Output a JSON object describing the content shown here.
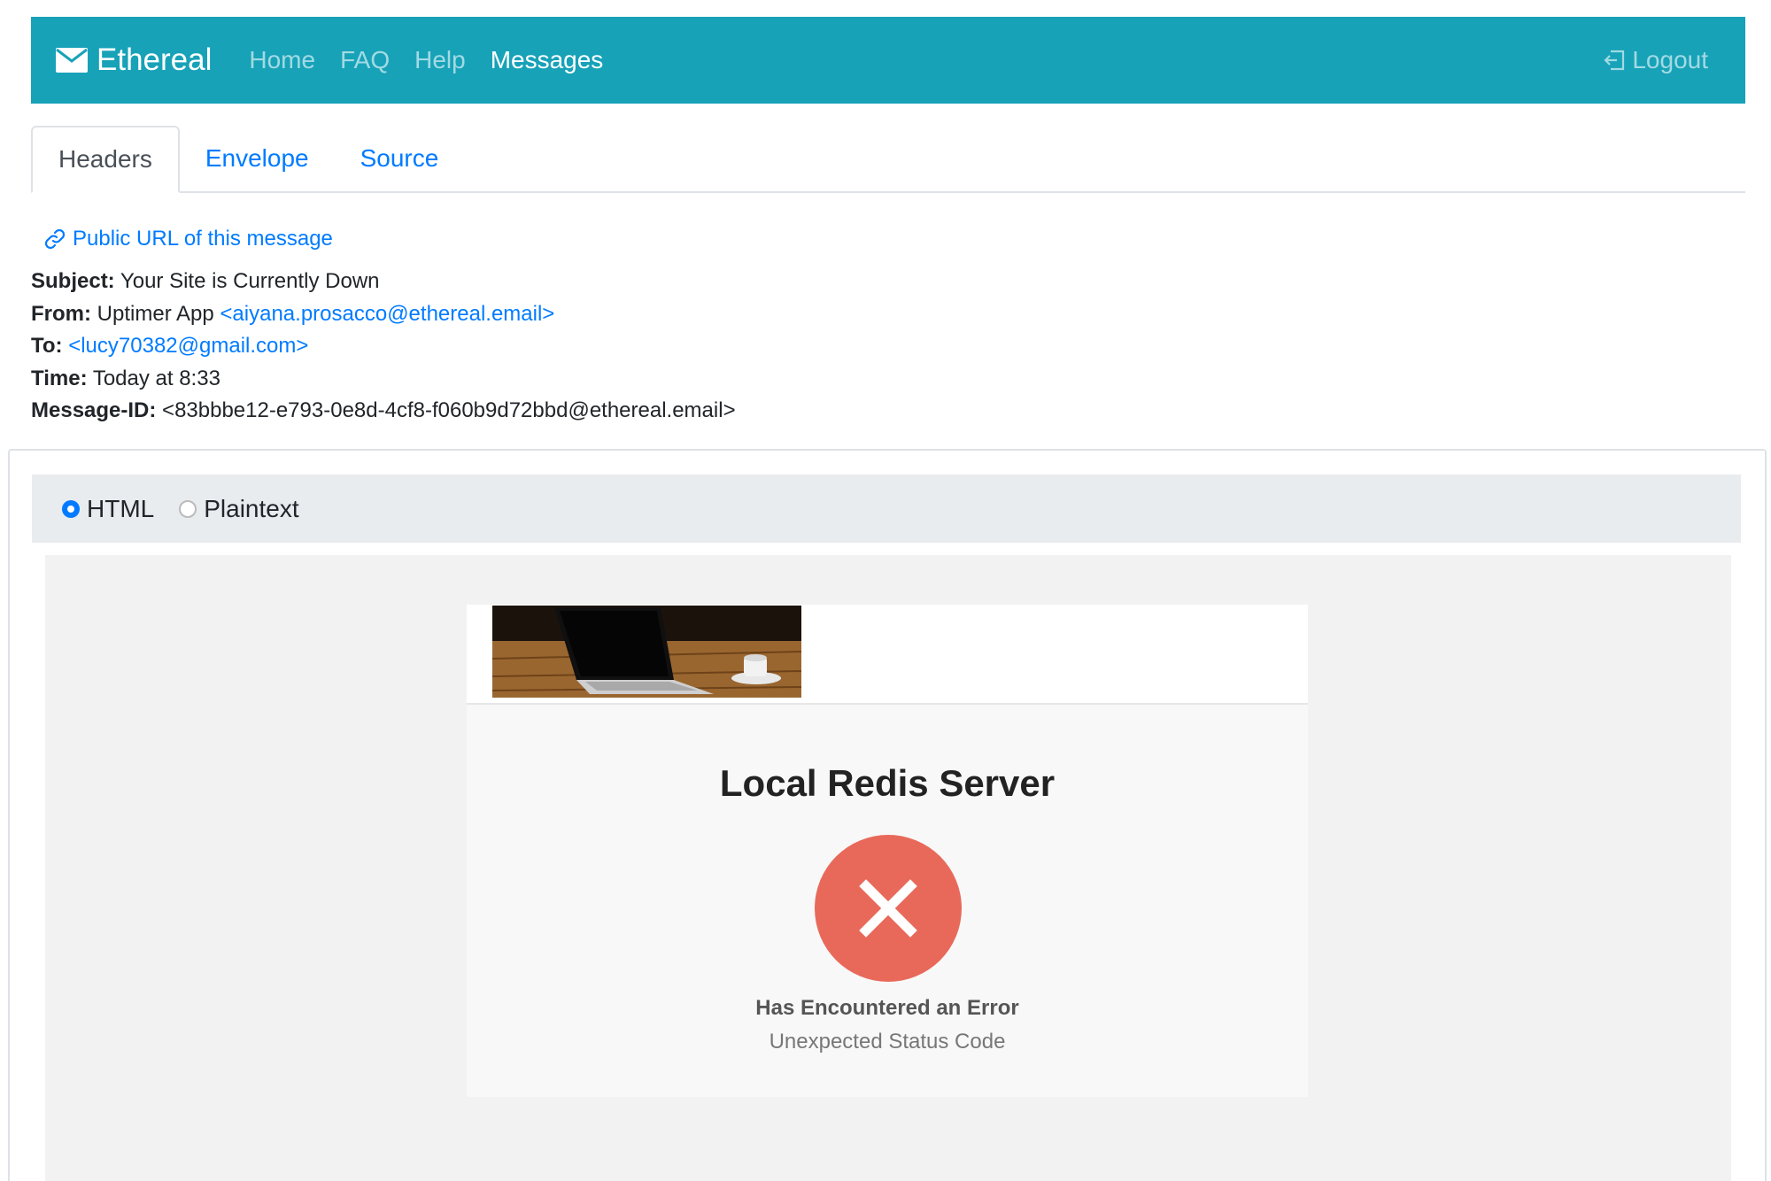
{
  "navbar": {
    "brand": "Ethereal",
    "links": [
      "Home",
      "FAQ",
      "Help",
      "Messages"
    ],
    "active_link": "Messages",
    "logout": "Logout",
    "color": "#17a2b8"
  },
  "tabs": [
    "Headers",
    "Envelope",
    "Source"
  ],
  "active_tab": "Headers",
  "public_url": "Public URL of this message",
  "message": {
    "subject_label": "Subject:",
    "subject": "Your Site is Currently Down",
    "from_label": "From:",
    "from_name": "Uptimer App",
    "from_email": "<aiyana.prosacco@ethereal.email>",
    "to_label": "To:",
    "to_email": "<lucy70382@gmail.com>",
    "time_label": "Time:",
    "time": "Today at 8:33",
    "id_label": "Message-ID:",
    "message_id": "<83bbbe12-e793-0e8d-4cf8-f060b9d72bbd@ethereal.email>"
  },
  "format": {
    "options": [
      "HTML",
      "Plaintext"
    ],
    "selected": "HTML"
  },
  "email": {
    "title": "Local Redis Server",
    "status": "Has Encountered an Error",
    "detail": "Unexpected Status Code",
    "error_color": "#e8695a",
    "image": "laptop-on-desk-image"
  }
}
